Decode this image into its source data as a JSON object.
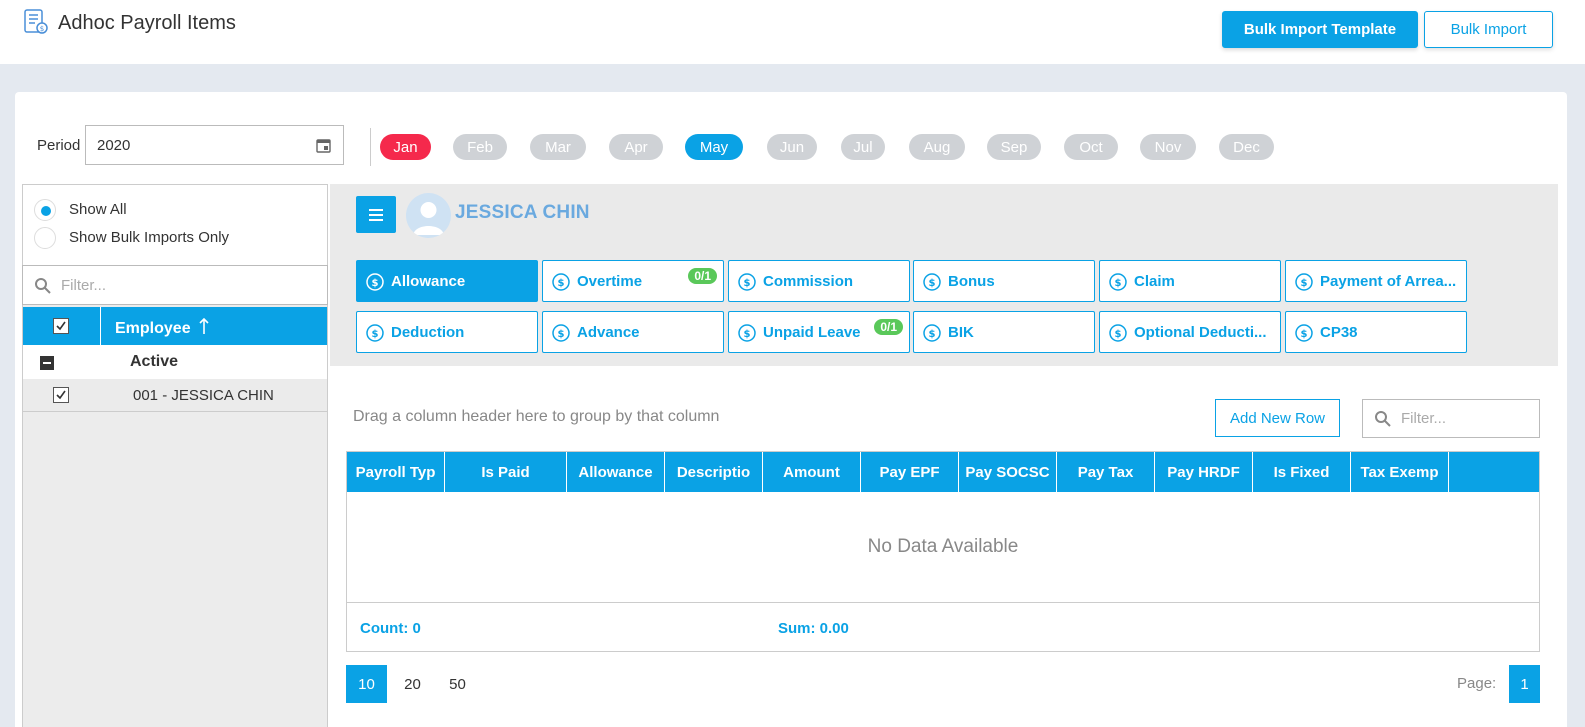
{
  "header": {
    "title": "Adhoc Payroll Items",
    "bulk_template_label": "Bulk Import Template",
    "bulk_import_label": "Bulk Import"
  },
  "period": {
    "label": "Period",
    "value": "2020",
    "months": [
      "Jan",
      "Feb",
      "Mar",
      "Apr",
      "May",
      "Jun",
      "Jul",
      "Aug",
      "Sep",
      "Oct",
      "Nov",
      "Dec"
    ],
    "highlighted_red": "Jan",
    "selected": "May"
  },
  "left_panel": {
    "show_all_label": "Show All",
    "show_bulk_label": "Show Bulk Imports Only",
    "filter_placeholder": "Filter...",
    "employee_header": "Employee",
    "group_label": "Active",
    "employees": [
      "001 - JESSICA CHIN"
    ]
  },
  "employee": {
    "name": "JESSICA CHIN"
  },
  "tabs": [
    {
      "label": "Allowance",
      "icon": "allowance-icon",
      "badge": ""
    },
    {
      "label": "Overtime",
      "icon": "overtime-icon",
      "badge": "0/1"
    },
    {
      "label": "Commission",
      "icon": "commission-icon",
      "badge": ""
    },
    {
      "label": "Bonus",
      "icon": "bonus-icon",
      "badge": ""
    },
    {
      "label": "Claim",
      "icon": "claim-icon",
      "badge": ""
    },
    {
      "label": "Payment of Arrea...",
      "icon": "payment-arrears-icon",
      "badge": ""
    },
    {
      "label": "Deduction",
      "icon": "deduction-icon",
      "badge": ""
    },
    {
      "label": "Advance",
      "icon": "advance-icon",
      "badge": ""
    },
    {
      "label": "Unpaid Leave",
      "icon": "unpaid-leave-icon",
      "badge": "0/1"
    },
    {
      "label": "BIK",
      "icon": "bik-icon",
      "badge": ""
    },
    {
      "label": "Optional Deducti...",
      "icon": "optional-deduction-icon",
      "badge": ""
    },
    {
      "label": "CP38",
      "icon": "cp38-icon",
      "badge": ""
    }
  ],
  "grid": {
    "drag_hint": "Drag a column header here to group by that column",
    "add_row_label": "Add New Row",
    "filter_placeholder": "Filter...",
    "columns": [
      "Payroll Typ",
      "Is Paid",
      "Allowance",
      "Descriptio",
      "Amount",
      "Pay EPF",
      "Pay SOCSC",
      "Pay Tax",
      "Pay HRDF",
      "Is Fixed",
      "Tax Exemp"
    ],
    "empty_text": "No Data Available",
    "count_label": "Count: 0",
    "sum_label": "Sum: 0.00"
  },
  "pager": {
    "sizes": [
      "10",
      "20",
      "50"
    ],
    "selected_size": "10",
    "page_label": "Page:",
    "current_page": "1"
  },
  "colors": {
    "primary": "#0aa2e5",
    "danger": "#f5294c",
    "badge": "#5ac85a"
  }
}
